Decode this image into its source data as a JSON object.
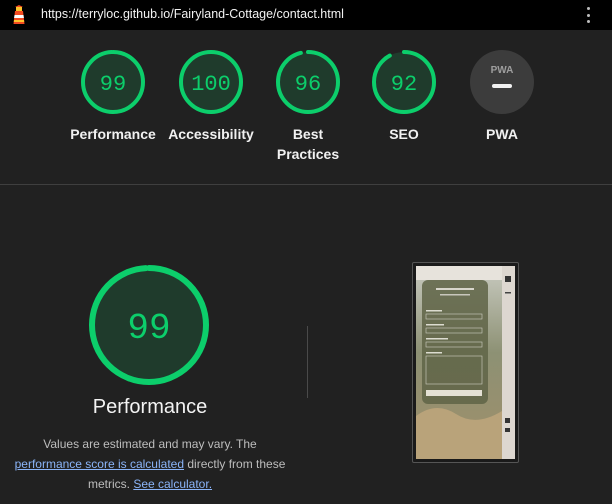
{
  "url": "https://terryloc.github.io/Fairyland-Cottage/contact.html",
  "colors": {
    "pass": "#0cce6b",
    "pass_fill": "#1f3b2c",
    "pwa_bg": "#3c3c3c",
    "link": "#8ab4f8"
  },
  "icons": {
    "logo": "lighthouse-icon",
    "menu": "kebab-menu-icon"
  },
  "categories": [
    {
      "label": "Performance",
      "score": "99",
      "value": 0.99
    },
    {
      "label": "Accessibility",
      "score": "100",
      "value": 1.0
    },
    {
      "label": "Best Practices",
      "score": "96",
      "value": 0.96
    },
    {
      "label": "SEO",
      "score": "92",
      "value": 0.92
    },
    {
      "label": "PWA",
      "badge": "PWA"
    }
  ],
  "performance": {
    "score": "99",
    "value": 0.99,
    "title": "Performance",
    "desc_prefix": "Values are estimated and may vary. The",
    "link1": "performance score is calculated",
    "desc_middle": "directly from these metrics.",
    "link2": "See calculator."
  }
}
